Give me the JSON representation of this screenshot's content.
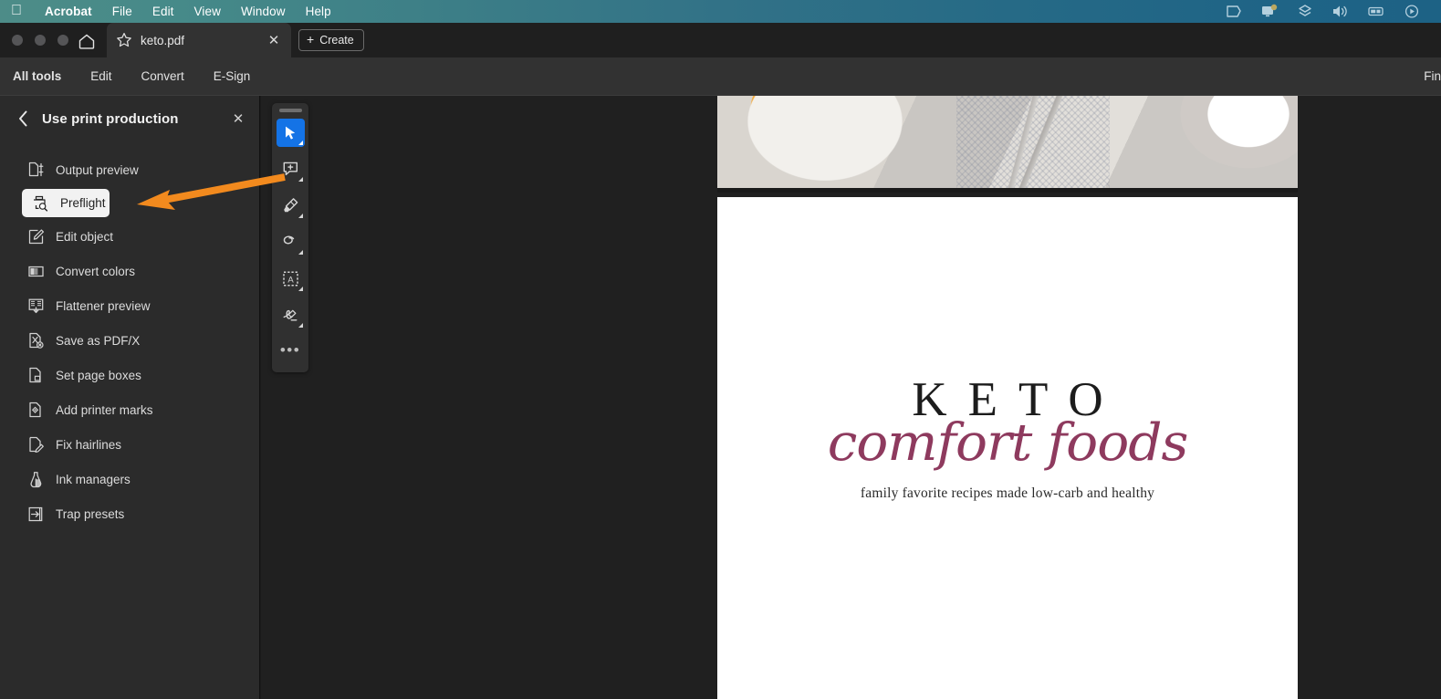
{
  "menubar": {
    "apple_icon": "apple-logo-icon",
    "items": [
      {
        "label": "Acrobat",
        "bold": true
      },
      {
        "label": "File",
        "bold": false
      },
      {
        "label": "Edit",
        "bold": false
      },
      {
        "label": "View",
        "bold": false
      },
      {
        "label": "Window",
        "bold": false
      },
      {
        "label": "Help",
        "bold": false
      }
    ],
    "tray_icons": [
      "shield-vpn-icon",
      "notification-bell-icon",
      "dropbox-icon",
      "volume-icon",
      "battery-icon",
      "control-center-icon"
    ],
    "gradient_left": "#4d8c88",
    "gradient_right": "#1d6285"
  },
  "titlebar": {
    "traffic_lights": [
      "close",
      "minimize",
      "zoom"
    ],
    "home_icon": "home-icon",
    "tab": {
      "star_icon": "star-outline-icon",
      "label": "keto.pdf",
      "close_icon": "close-icon"
    },
    "create_button": {
      "plus": "+",
      "label": "Create"
    }
  },
  "toolsbar": {
    "items": [
      {
        "label": "All tools",
        "bold": true
      },
      {
        "label": "Edit",
        "bold": false
      },
      {
        "label": "Convert",
        "bold": false
      },
      {
        "label": "E-Sign",
        "bold": false
      }
    ],
    "right_label": "Fin"
  },
  "panel": {
    "back_icon": "chevron-left-icon",
    "title": "Use print production",
    "close_icon": "close-icon",
    "items": [
      {
        "label": "Output preview",
        "icon": "output-preview-icon",
        "selected": false
      },
      {
        "label": "Preflight",
        "icon": "preflight-icon",
        "selected": true
      },
      {
        "label": "Edit object",
        "icon": "edit-object-icon",
        "selected": false
      },
      {
        "label": "Convert colors",
        "icon": "convert-colors-icon",
        "selected": false
      },
      {
        "label": "Flattener preview",
        "icon": "flattener-preview-icon",
        "selected": false
      },
      {
        "label": "Save as PDF/X",
        "icon": "save-pdfx-icon",
        "selected": false
      },
      {
        "label": "Set page boxes",
        "icon": "set-page-boxes-icon",
        "selected": false
      },
      {
        "label": "Add printer marks",
        "icon": "add-printer-marks-icon",
        "selected": false
      },
      {
        "label": "Fix hairlines",
        "icon": "fix-hairlines-icon",
        "selected": false
      },
      {
        "label": "Ink managers",
        "icon": "ink-managers-icon",
        "selected": false
      },
      {
        "label": "Trap presets",
        "icon": "trap-presets-icon",
        "selected": false
      }
    ]
  },
  "float_toolbar": {
    "grip": "drag-handle",
    "tools": [
      {
        "icon": "select-cursor-icon",
        "active": true
      },
      {
        "icon": "add-comment-icon",
        "active": false
      },
      {
        "icon": "highlighter-icon",
        "active": false
      },
      {
        "icon": "draw-freehand-icon",
        "active": false
      },
      {
        "icon": "text-select-icon",
        "active": false
      },
      {
        "icon": "signature-icon",
        "active": false
      }
    ],
    "more_label": "•••"
  },
  "document": {
    "page_preview_alt": "food-photograph",
    "logo": {
      "title": "KETO",
      "script": "comfort foods",
      "tagline": "family favorite recipes made low-carb and healthy",
      "script_color": "#8e3a5e"
    }
  },
  "annotation": {
    "arrow_color": "#f28a1e",
    "arrow_points_to": "Preflight"
  }
}
